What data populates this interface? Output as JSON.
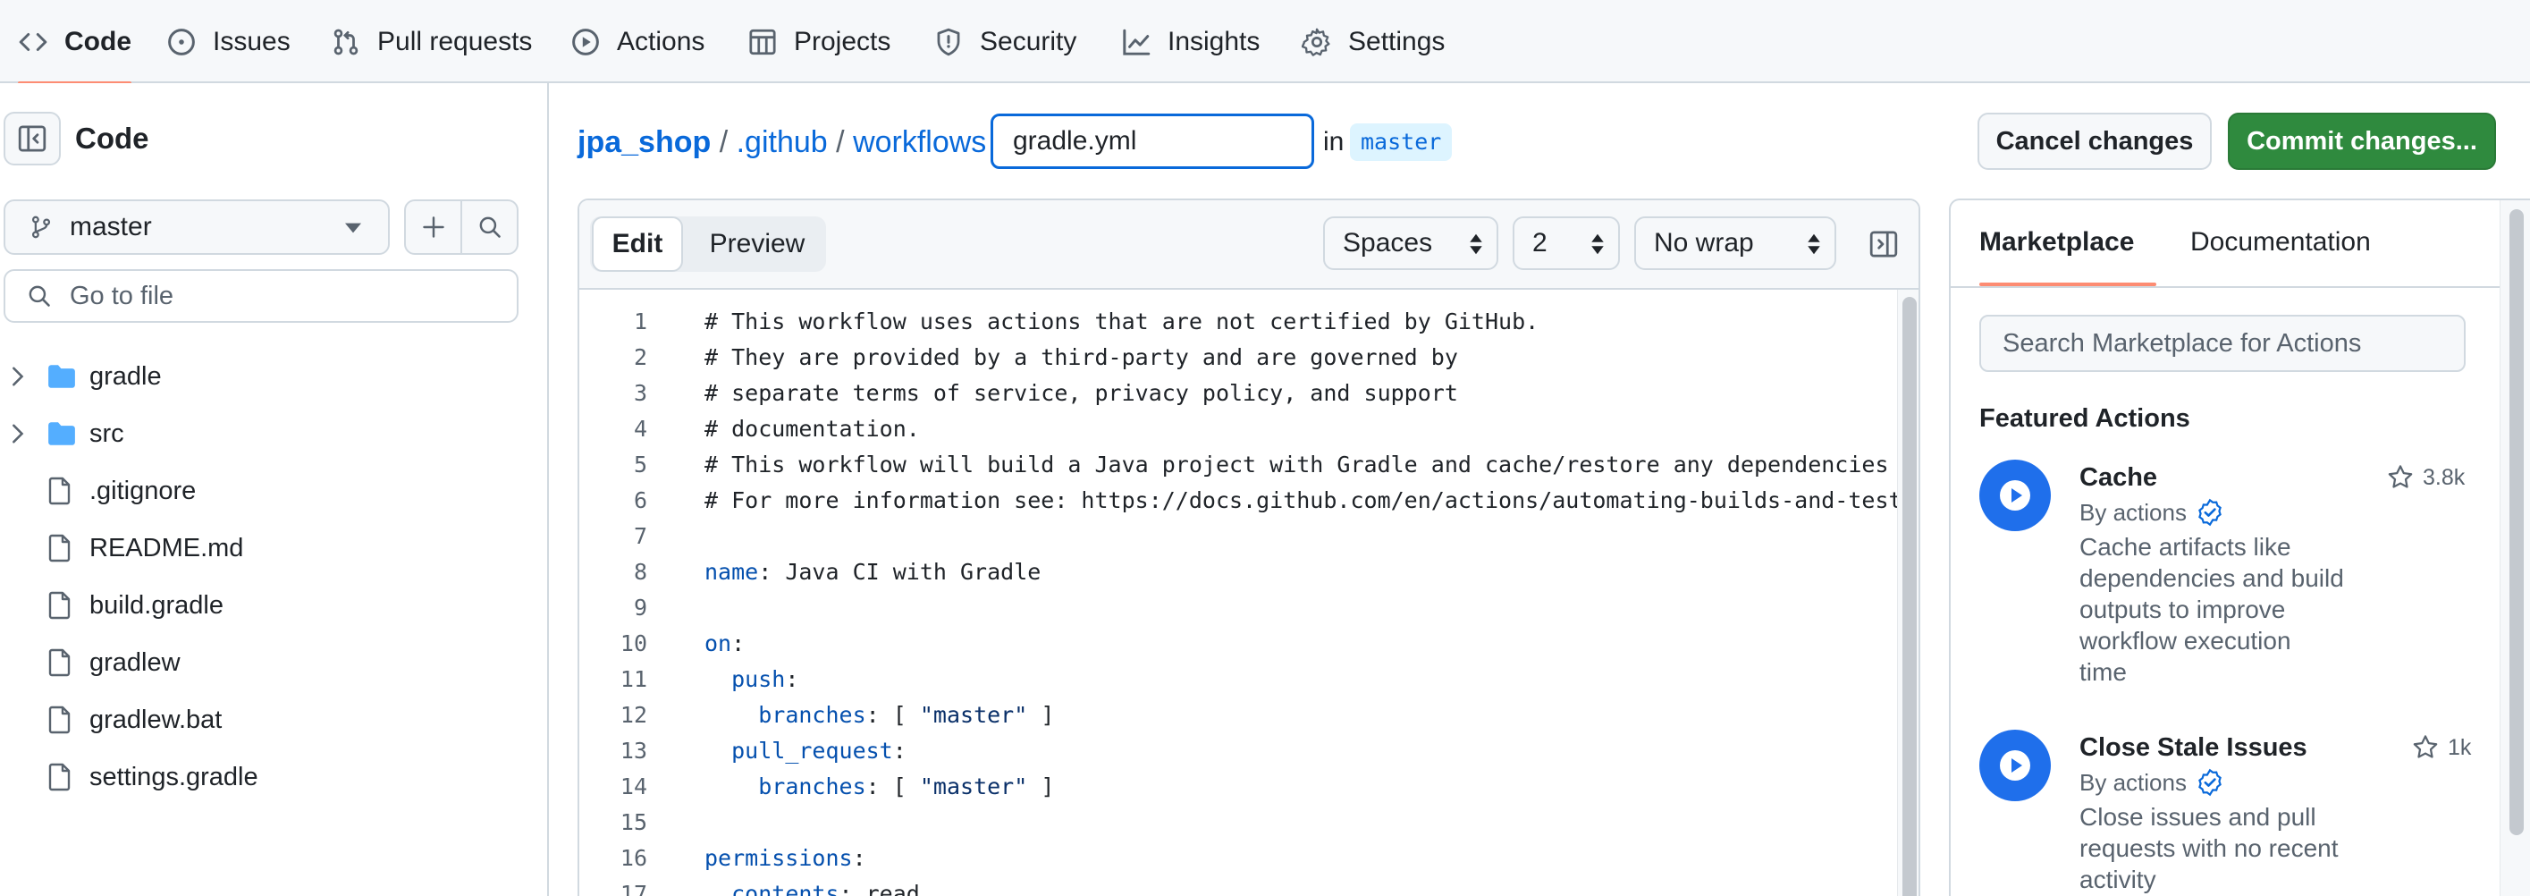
{
  "nav": {
    "tabs": [
      {
        "label": "Code",
        "icon": "code-icon"
      },
      {
        "label": "Issues",
        "icon": "issue-icon"
      },
      {
        "label": "Pull requests",
        "icon": "pull-request-icon"
      },
      {
        "label": "Actions",
        "icon": "play-icon"
      },
      {
        "label": "Projects",
        "icon": "table-icon"
      },
      {
        "label": "Security",
        "icon": "shield-icon"
      },
      {
        "label": "Insights",
        "icon": "graph-icon"
      },
      {
        "label": "Settings",
        "icon": "gear-icon"
      }
    ],
    "active": "Code"
  },
  "sidebar": {
    "title": "Code",
    "branch": "master",
    "search_placeholder": "Go to file",
    "tree": [
      {
        "name": "gradle",
        "type": "folder"
      },
      {
        "name": "src",
        "type": "folder"
      },
      {
        "name": ".gitignore",
        "type": "file"
      },
      {
        "name": "README.md",
        "type": "file"
      },
      {
        "name": "build.gradle",
        "type": "file"
      },
      {
        "name": "gradlew",
        "type": "file"
      },
      {
        "name": "gradlew.bat",
        "type": "file"
      },
      {
        "name": "settings.gradle",
        "type": "file"
      }
    ]
  },
  "breadcrumb": {
    "repo": "jpa_shop",
    "dir1": ".github",
    "dir2": "workflows",
    "sep": "/",
    "filename": "gradle.yml",
    "in_label": "in",
    "branch": "master"
  },
  "header_actions": {
    "cancel": "Cancel changes",
    "commit": "Commit changes..."
  },
  "editor": {
    "tabs": {
      "edit": "Edit",
      "preview": "Preview"
    },
    "indent_mode": "Spaces",
    "indent_size": "2",
    "wrap_mode": "No wrap",
    "lines": [
      {
        "n": "1",
        "text": "# This workflow uses actions that are not certified by GitHub."
      },
      {
        "n": "2",
        "text": "# They are provided by a third-party and are governed by"
      },
      {
        "n": "3",
        "text": "# separate terms of service, privacy policy, and support"
      },
      {
        "n": "4",
        "text": "# documentation."
      },
      {
        "n": "5",
        "text": "# This workflow will build a Java project with Gradle and cache/restore any dependencies to"
      },
      {
        "n": "6",
        "text": "# For more information see: https://docs.github.com/en/actions/automating-builds-and-tests/b"
      },
      {
        "n": "7",
        "text": ""
      },
      {
        "n": "8",
        "key": "name",
        "rest": ": Java CI with Gradle"
      },
      {
        "n": "9",
        "text": ""
      },
      {
        "n": "10",
        "key": "on",
        "rest": ":"
      },
      {
        "n": "11",
        "indent": "  ",
        "key": "push",
        "rest": ":"
      },
      {
        "n": "12",
        "indent": "    ",
        "key": "branches",
        "rest": ": [ ",
        "str": "\"master\"",
        "after": " ]"
      },
      {
        "n": "13",
        "indent": "  ",
        "key": "pull_request",
        "rest": ":"
      },
      {
        "n": "14",
        "indent": "    ",
        "key": "branches",
        "rest": ": [ ",
        "str": "\"master\"",
        "after": " ]"
      },
      {
        "n": "15",
        "text": ""
      },
      {
        "n": "16",
        "key": "permissions",
        "rest": ":"
      },
      {
        "n": "17",
        "indent": "  ",
        "key": "contents",
        "rest": ": read"
      }
    ]
  },
  "marketplace": {
    "tabs": {
      "marketplace": "Marketplace",
      "documentation": "Documentation"
    },
    "search_placeholder": "Search Marketplace for Actions",
    "featured_title": "Featured Actions",
    "actions": [
      {
        "name": "Cache",
        "by": "By actions",
        "stars": "3.8k",
        "desc": [
          "Cache artifacts like",
          "dependencies and build",
          "outputs to improve",
          "workflow execution",
          "time"
        ]
      },
      {
        "name": "Close Stale Issues",
        "by": "By actions",
        "stars": "1k",
        "desc": [
          "Close issues and pull",
          "requests with no recent",
          "activity"
        ]
      }
    ]
  },
  "colors": {
    "accent_blue": "#0969da",
    "commit_green": "#2da44e",
    "active_tab_underline": "#fd8c73",
    "folder_blue": "#54aeff"
  }
}
